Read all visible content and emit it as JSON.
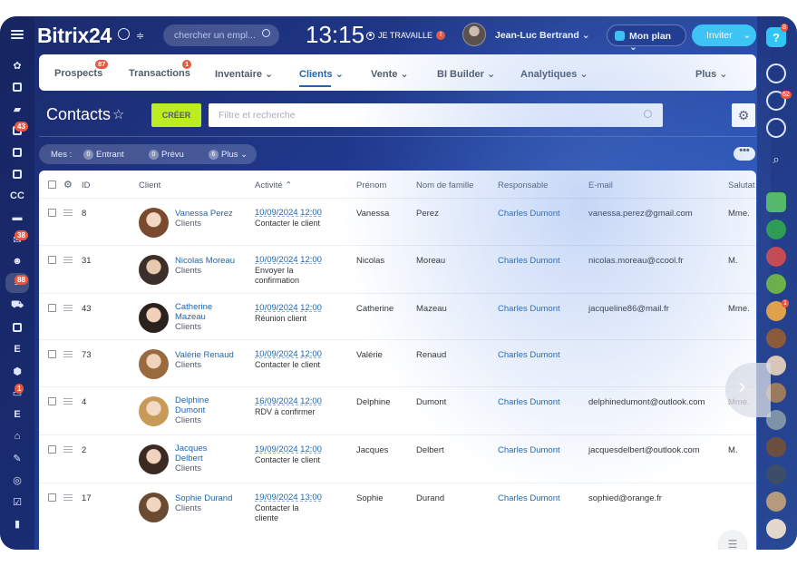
{
  "header": {
    "logo": "Bitrix24",
    "search_placeholder": "chercher un empl...",
    "time": "13:15",
    "work_status": "JE TRAVAILLE",
    "work_alert": "!",
    "user_name": "Jean-Luc Bertrand",
    "plan_label": "Mon plan",
    "invite_label": "Inviter"
  },
  "leftbar": {
    "badges": {
      "tasks": "43",
      "mail": "38",
      "crm": "88",
      "shop": "1"
    },
    "labels": {
      "cc": "CC",
      "e1": "E",
      "e2": "E"
    }
  },
  "rightbar": {
    "help": "?",
    "help_badge": "8",
    "notif_badge": "62",
    "chat_badge": "1"
  },
  "nav": {
    "items": [
      {
        "label": "Prospects",
        "badge": "87"
      },
      {
        "label": "Transactions",
        "badge": "1"
      },
      {
        "label": "Inventaire ⌄"
      },
      {
        "label": "Clients ⌄"
      },
      {
        "label": "Vente ⌄"
      },
      {
        "label": "BI Builder ⌄"
      },
      {
        "label": "Analytiques ⌄"
      },
      {
        "label": "Plus ⌄"
      }
    ]
  },
  "toolbar": {
    "title": "Contacts",
    "create_label": "CRÉER",
    "filter_placeholder": "Filtre et recherche"
  },
  "counters": {
    "mes": "Mes :",
    "items": [
      {
        "num": "0",
        "label": "Entrant"
      },
      {
        "num": "0",
        "label": "Prévu"
      },
      {
        "num": "6",
        "label": "Plus ⌄"
      }
    ],
    "more": "•••"
  },
  "table": {
    "headers": {
      "id": "ID",
      "client": "Client",
      "activity": "Activité ⌃",
      "firstname": "Prénom",
      "lastname": "Nom de famille",
      "responsible": "Responsable",
      "email": "E-mail",
      "salutation": "Salutat"
    },
    "rows": [
      {
        "id": "8",
        "name1": "Vanessa Perez",
        "name2": "",
        "type": "Clients",
        "date": "10/09/2024 12:00",
        "act1": "Contacter le client",
        "act2": "",
        "first": "Vanessa",
        "last": "Perez",
        "resp": "Charles Dumont",
        "email": "vanessa.perez@gmail.com",
        "sal": "Mme."
      },
      {
        "id": "31",
        "name1": "Nicolas Moreau",
        "name2": "",
        "type": "Clients",
        "date": "10/09/2024 12:00",
        "act1": "Envoyer la",
        "act2": "confirmation",
        "first": "Nicolas",
        "last": "Moreau",
        "resp": "Charles Dumont",
        "email": "nicolas.moreau@ccool.fr",
        "sal": "M."
      },
      {
        "id": "43",
        "name1": "Catherine",
        "name2": "Mazeau",
        "type": "Clients",
        "date": "10/09/2024 12:00",
        "act1": "Réunion client",
        "act2": "",
        "first": "Catherine",
        "last": "Mazeau",
        "resp": "Charles Dumont",
        "email": "jacqueline86@mail.fr",
        "sal": "Mme."
      },
      {
        "id": "73",
        "name1": "Valérie Renaud",
        "name2": "",
        "type": "Clients",
        "date": "10/09/2024 12:00",
        "act1": "Contacter le client",
        "act2": "",
        "first": "Valérie",
        "last": "Renaud",
        "resp": "Charles Dumont",
        "email": "",
        "sal": ""
      },
      {
        "id": "4",
        "name1": "Delphine",
        "name2": "Dumont",
        "type": "Clients",
        "date": "16/09/2024 12:00",
        "act1": "RDV à confirmer",
        "act2": "",
        "first": "Delphine",
        "last": "Dumont",
        "resp": "Charles Dumont",
        "email": "delphinedumont@outlook.com",
        "sal": "Mme."
      },
      {
        "id": "2",
        "name1": "Jacques",
        "name2": "Delbert",
        "type": "Clients",
        "date": "19/09/2024 12:00",
        "act1": "Contacter le client",
        "act2": "",
        "first": "Jacques",
        "last": "Delbert",
        "resp": "Charles Dumont",
        "email": "jacquesdelbert@outlook.com",
        "sal": "M."
      },
      {
        "id": "17",
        "name1": "Sophie Durand",
        "name2": "",
        "type": "Clients",
        "date": "19/09/2024 13:00",
        "act1": "Contacter la",
        "act2": "cliente",
        "first": "Sophie",
        "last": "Durand",
        "resp": "Charles Dumont",
        "email": "sophied@orange.fr",
        "sal": ""
      }
    ]
  },
  "colors": {
    "accent": "#2067b0",
    "create": "#bbed21",
    "badge": "#e9573f",
    "invite": "#3bc8f5"
  }
}
